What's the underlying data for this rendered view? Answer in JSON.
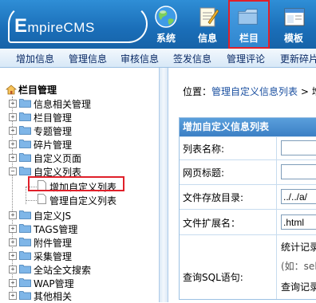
{
  "header": {
    "logo": "EmpireCMS",
    "nav": [
      {
        "label": "系统",
        "icon": "globe-icon"
      },
      {
        "label": "信息",
        "icon": "notepad-icon"
      },
      {
        "label": "栏目",
        "icon": "folder-icon",
        "active": true
      },
      {
        "label": "模板",
        "icon": "window-icon"
      }
    ]
  },
  "menubar": [
    "增加信息",
    "管理信息",
    "审核信息",
    "签发信息",
    "管理评论",
    "更新碎片"
  ],
  "tree": {
    "root": "栏目管理",
    "items": [
      "信息相关管理",
      "栏目管理",
      "专题管理",
      "碎片管理",
      "自定义页面",
      "自定义列表",
      "增加自定义列表",
      "管理自定义列表",
      "自定义JS",
      "TAGS管理",
      "附件管理",
      "采集管理",
      "全站全文搜索",
      "WAP管理",
      "其他相关"
    ]
  },
  "content": {
    "breadcrumb": {
      "prefix": "位置：",
      "link": "管理自定义信息列表",
      "sep": " > ",
      "next": "增"
    },
    "form": {
      "title": "增加自定义信息列表",
      "fields": [
        {
          "label": "列表名称:",
          "value": ""
        },
        {
          "label": "网页标题:",
          "value": ""
        },
        {
          "label": "文件存放目录:",
          "value": "../../a/"
        },
        {
          "label": "文件扩展名：",
          "value": ".html"
        },
        {
          "label": "查询SQL语句:",
          "line1": "统计记录",
          "line2": "(如：sel",
          "line3": "查询记录"
        }
      ]
    }
  },
  "colors": {
    "accent": "#1a6eb8",
    "highlight": "#e0202a"
  }
}
